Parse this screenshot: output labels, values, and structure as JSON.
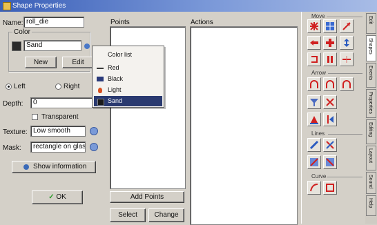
{
  "window": {
    "title": "Shape Properties"
  },
  "form": {
    "name_label": "Name:",
    "name_value": "roll_die",
    "color_group_label": "Color",
    "color_value": "Sand",
    "new_button": "New",
    "edit_button": "Edit",
    "side_left_label": "Left",
    "side_right_label": "Right",
    "depth_label": "Depth:",
    "depth_value": "0",
    "transparent_label": "Transparent",
    "texture_label": "Texture:",
    "texture_value": "Low smooth",
    "mask_label": "Mask:",
    "mask_value": "rectangle on glass",
    "show_btn_label": "Show information",
    "ok_label": "OK"
  },
  "color_menu": {
    "items": [
      {
        "label": "Color list",
        "icon": "none-icon",
        "color": ""
      },
      {
        "label": "Red",
        "icon": "line-icon",
        "color": "#3a3a3a"
      },
      {
        "label": "Black",
        "icon": "bar-icon",
        "color": "#2a3a7a"
      },
      {
        "label": "Light",
        "icon": "flame-icon",
        "color": "#d85020"
      },
      {
        "label": "Sand",
        "icon": "glass-icon",
        "color": "#2a2a2a"
      }
    ],
    "selected_index": 4
  },
  "panels": {
    "points_title": "Points",
    "actions_title": "Actions",
    "add_points_label": "Add Points",
    "select_label": "Select",
    "change_label": "Change"
  },
  "toolbox": {
    "sections": [
      {
        "label": "Move"
      },
      {
        "label": "Arrow"
      },
      {
        "label": "Lines"
      },
      {
        "label": "Curve"
      }
    ],
    "tool_icons": [
      "burst-icon",
      "grid-icon",
      "diagonal-arrow-icon",
      "left-arrow-icon",
      "cross-arrow-icon",
      "updown-arrow-icon",
      "rotate-icon",
      "pause-arrows-icon",
      "split-arrow-icon",
      "arch-icon",
      "arch-icon",
      "arch-icon",
      "funnel-icon",
      "scissor-icon",
      "triangle-flag-icon",
      "k-arrow-icon",
      "pencil-icon",
      "x-mark-icon",
      "line-segment-icon",
      "grid-cross-icon",
      "curve-line-icon",
      "square-grid-icon"
    ]
  },
  "vtabs": [
    "Edit",
    "Shapes",
    "Events",
    "Properties",
    "Editing",
    "Layout",
    "Sound",
    "Help"
  ]
}
